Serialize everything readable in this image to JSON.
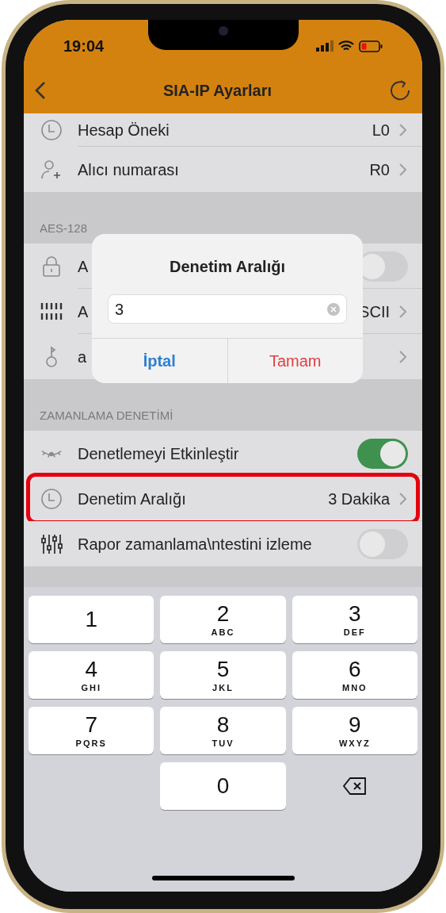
{
  "status_bar": {
    "time": "19:04"
  },
  "nav": {
    "title": "SIA-IP Ayarları"
  },
  "sections": [
    {
      "rows": [
        {
          "kind": "value",
          "label": "Hesap Öneki",
          "value": "L0"
        },
        {
          "kind": "value",
          "label": "Alıcı numarası",
          "value": "R0"
        }
      ]
    },
    {
      "header": "AES-128",
      "rows": [
        {
          "kind": "toggle",
          "label": "A",
          "on": false
        },
        {
          "kind": "value",
          "label": "A",
          "value": "SCII"
        },
        {
          "kind": "value",
          "label": "a"
        }
      ]
    },
    {
      "header": "ZAMANLAMA DENETİMİ",
      "rows": [
        {
          "kind": "toggle",
          "label": "Denetlemeyi Etkinleştir",
          "on": true
        },
        {
          "kind": "value",
          "label": "Denetim Aralığı",
          "value": "3 Dakika",
          "highlighted": true
        },
        {
          "kind": "toggle",
          "label": "Rapor zamanlama\\ntestini izleme",
          "on": false
        }
      ]
    }
  ],
  "dialog": {
    "title": "Denetim Aralığı",
    "value": "3",
    "buttons": [
      {
        "label": "İptal",
        "kind": "cancel"
      },
      {
        "label": "Tamam",
        "kind": "confirm"
      }
    ]
  },
  "keyboard": {
    "keys": [
      {
        "kind": "digit",
        "digit": "1"
      },
      {
        "kind": "digit",
        "digit": "2",
        "letters": "ABC"
      },
      {
        "kind": "digit",
        "digit": "3",
        "letters": "DEF"
      },
      {
        "kind": "digit",
        "digit": "4",
        "letters": "GHI"
      },
      {
        "kind": "digit",
        "digit": "5",
        "letters": "JKL"
      },
      {
        "kind": "digit",
        "digit": "6",
        "letters": "MNO"
      },
      {
        "kind": "digit",
        "digit": "7",
        "letters": "PQRS"
      },
      {
        "kind": "digit",
        "digit": "8",
        "letters": "TUV"
      },
      {
        "kind": "digit",
        "digit": "9",
        "letters": "WXYZ"
      },
      {
        "kind": "empty"
      },
      {
        "kind": "digit",
        "digit": "0"
      },
      {
        "kind": "delete"
      }
    ]
  }
}
